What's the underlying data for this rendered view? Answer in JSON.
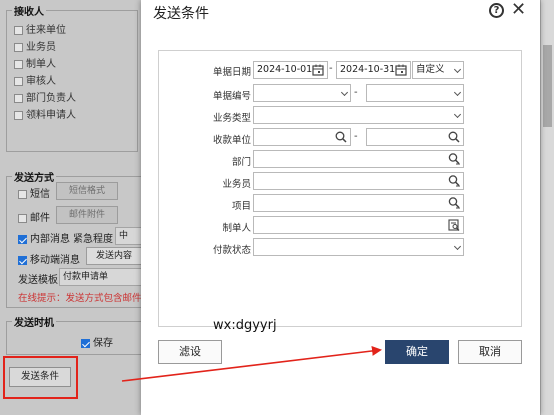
{
  "background": {
    "receivers": {
      "title": "接收人",
      "items": [
        "往来单位",
        "业务员",
        "制单人",
        "审核人",
        "部门负责人",
        "领料申请人"
      ]
    },
    "send_method": {
      "title": "发送方式",
      "sms_label": "短信",
      "sms_format_button": "短信格式",
      "email_label": "邮件",
      "email_attach_button": "邮件附件",
      "internal_msg_label": "内部消息",
      "urgency_label": "紧急程度",
      "urgency_value": "中",
      "mobile_msg_label": "移动端消息",
      "send_content_button": "发送内容",
      "template_label": "发送模板",
      "template_value": "付款申请单",
      "hint": "在线提示：发送方式包含邮件"
    },
    "send_time": {
      "title": "发送时机",
      "save_label": "保存"
    },
    "send_condition_button": "发送条件"
  },
  "dialog": {
    "title": "发送条件",
    "help_icon": "?",
    "close_icon": "✕",
    "fields": {
      "doc_date_label": "单据日期",
      "date_from": "2024-10-01",
      "date_to": "2024-10-31",
      "date_sep": "-",
      "date_mode": "自定义",
      "doc_no_label": "单据编号",
      "doc_no_sep": "-",
      "biz_type_label": "业务类型",
      "payee_label": "收款单位",
      "payee_sep": "-",
      "dept_label": "部门",
      "salesman_label": "业务员",
      "project_label": "项目",
      "creator_label": "制单人",
      "pay_status_label": "付款状态"
    },
    "filter_button": "滤设",
    "ok_button": "确定",
    "cancel_button": "取消"
  },
  "watermark": "wx:dgyyrj",
  "colors": {
    "primary": "#29456e",
    "annotation_red": "#e2231a",
    "hint_red": "#cc3333"
  }
}
